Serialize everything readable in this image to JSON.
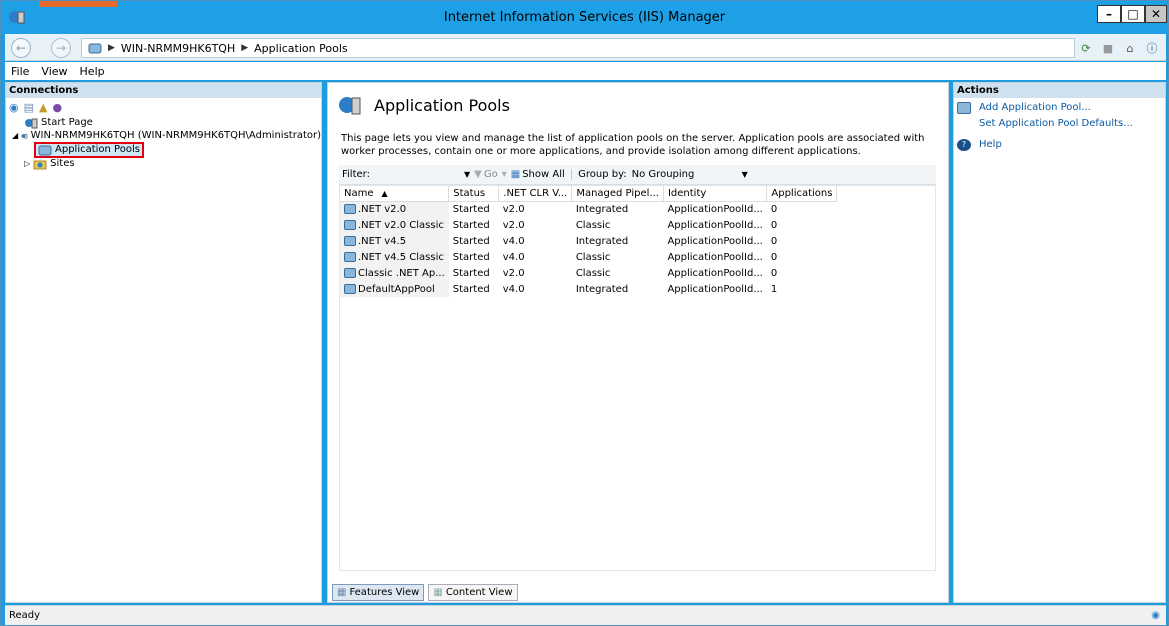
{
  "window": {
    "title": "Internet Information Services (IIS) Manager"
  },
  "address": {
    "crumbs": [
      "WIN-NRMM9HK6TQH",
      "Application Pools"
    ]
  },
  "menu": [
    "File",
    "View",
    "Help"
  ],
  "connections": {
    "header": "Connections",
    "tree": {
      "start_page": "Start Page",
      "server": "WIN-NRMM9HK6TQH (WIN-NRMM9HK6TQH\\Administrator)",
      "app_pools": "Application Pools",
      "sites": "Sites"
    }
  },
  "main": {
    "title": "Application Pools",
    "description": "This page lets you view and manage the list of application pools on the server. Application pools are associated with worker processes, contain one or more applications, and provide isolation among different applications.",
    "filter": {
      "label": "Filter:",
      "go": "Go",
      "show_all": "Show All",
      "group_by_label": "Group by:",
      "group_by_value": "No Grouping"
    },
    "columns": [
      "Name",
      "Status",
      ".NET CLR V...",
      "Managed Pipel...",
      "Identity",
      "Applications"
    ],
    "rows": [
      [
        ".NET v2.0",
        "Started",
        "v2.0",
        "Integrated",
        "ApplicationPoolId...",
        "0"
      ],
      [
        ".NET v2.0 Classic",
        "Started",
        "v2.0",
        "Classic",
        "ApplicationPoolId...",
        "0"
      ],
      [
        ".NET v4.5",
        "Started",
        "v4.0",
        "Integrated",
        "ApplicationPoolId...",
        "0"
      ],
      [
        ".NET v4.5 Classic",
        "Started",
        "v4.0",
        "Classic",
        "ApplicationPoolId...",
        "0"
      ],
      [
        "Classic .NET Ap...",
        "Started",
        "v2.0",
        "Classic",
        "ApplicationPoolId...",
        "0"
      ],
      [
        "DefaultAppPool",
        "Started",
        "v4.0",
        "Integrated",
        "ApplicationPoolId...",
        "1"
      ]
    ],
    "tabs": {
      "features": "Features View",
      "content": "Content View"
    }
  },
  "actions": {
    "header": "Actions",
    "items": [
      "Add Application Pool...",
      "Set Application Pool Defaults...",
      "Help"
    ]
  },
  "status": {
    "text": "Ready"
  },
  "colors": {
    "titlebar": "#1ea0e6",
    "link": "#0a5aa0",
    "highlight": "#e00010"
  }
}
